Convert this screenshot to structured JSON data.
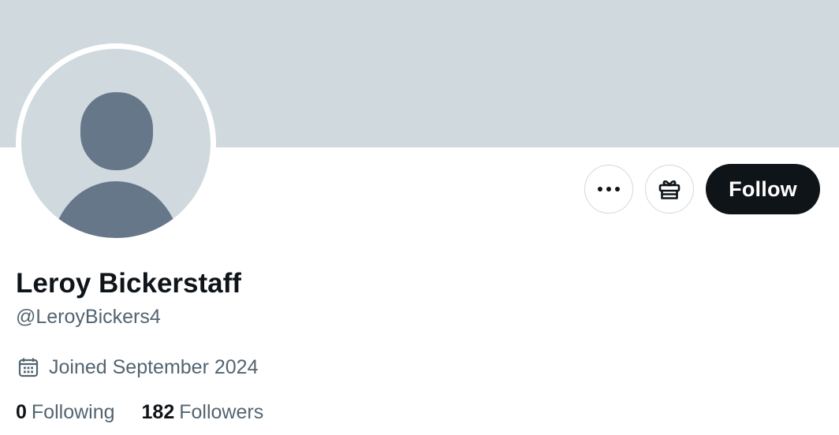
{
  "profile": {
    "display_name": "Leroy Bickerstaff",
    "handle": "@LeroyBickers4",
    "joined": "Joined September 2024",
    "banner_color": "#cfd9de",
    "avatar_placeholder_color": "#cfd9de",
    "avatar_silhouette_color": "#66778a"
  },
  "actions": {
    "more_icon": "more-horizontal-icon",
    "gift_icon": "gift-icon",
    "follow_label": "Follow"
  },
  "stats": {
    "following_count": "0",
    "following_label": "Following",
    "followers_count": "182",
    "followers_label": "Followers"
  },
  "icons": {
    "calendar": "calendar-icon"
  },
  "colors": {
    "primary_text": "#0f1419",
    "secondary_text": "#536471",
    "border": "#cfd9de",
    "follow_button_bg": "#0f1419",
    "follow_button_text": "#ffffff"
  }
}
